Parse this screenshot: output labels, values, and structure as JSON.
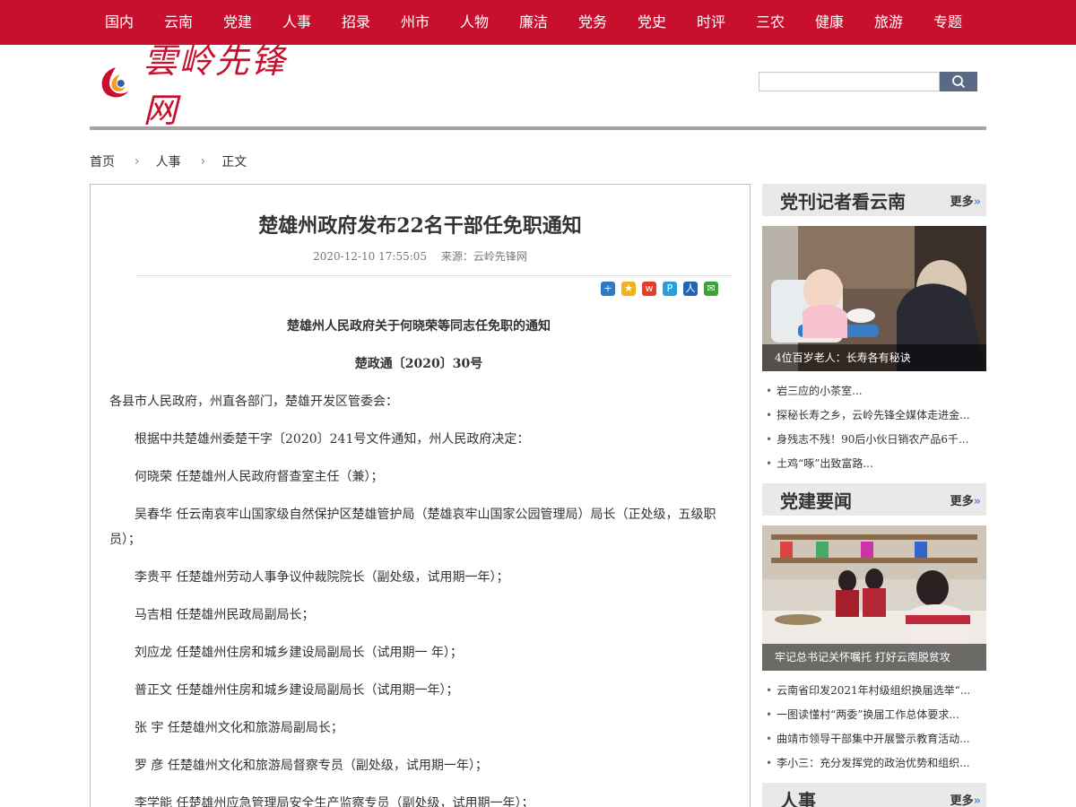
{
  "nav": [
    "国内",
    "云南",
    "党建",
    "人事",
    "招录",
    "州市",
    "人物",
    "廉洁",
    "党务",
    "党史",
    "时评",
    "三农",
    "健康",
    "旅游",
    "专题"
  ],
  "header": {
    "logo_text": "雲岭先锋网",
    "search_placeholder": ""
  },
  "breadcrumb": {
    "home": "首页",
    "section": "人事",
    "current": "正文"
  },
  "article": {
    "title": "楚雄州政府发布22名干部任免职通知",
    "date": "2020-12-10 17:55:05",
    "source": "来源：云岭先锋网",
    "share_icons": [
      "plus-share-icon",
      "qzone-share-icon",
      "weibo-share-icon",
      "qq-share-icon",
      "renren-share-icon",
      "wechat-share-icon"
    ],
    "paragraphs": [
      {
        "style": "center",
        "text": "楚雄州人民政府关于何晓荣等同志任免职的通知"
      },
      {
        "style": "center",
        "text": "楚政通〔2020〕30号"
      },
      {
        "style": "noindent",
        "text": "各县市人民政府，州直各部门，楚雄开发区管委会："
      },
      {
        "style": "indent",
        "text": "根据中共楚雄州委楚干字〔2020〕241号文件通知，州人民政府决定："
      },
      {
        "style": "indent",
        "text": "何晓荣 任楚雄州人民政府督查室主任（兼）；"
      },
      {
        "style": "indent",
        "text": "吴春华 任云南哀牢山国家级自然保护区楚雄管护局（楚雄哀牢山国家公园管理局）局长（正处级，五级职员）；"
      },
      {
        "style": "indent",
        "text": "李贵平 任楚雄州劳动人事争议仲裁院院长（副处级，试用期一年）；"
      },
      {
        "style": "indent",
        "text": "马吉相 任楚雄州民政局副局长；"
      },
      {
        "style": "indent",
        "text": "刘应龙 任楚雄州住房和城乡建设局副局长（试用期一 年）；"
      },
      {
        "style": "indent",
        "text": "普正文 任楚雄州住房和城乡建设局副局长（试用期一年）；"
      },
      {
        "style": "indent",
        "text": "张 宇 任楚雄州文化和旅游局副局长；"
      },
      {
        "style": "indent",
        "text": "罗 彦 任楚雄州文化和旅游局督察专员（副处级，试用期一年）；"
      },
      {
        "style": "indent",
        "text": "李学能 任楚雄州应急管理局安全生产监察专员（副处级，试用期一年）；"
      }
    ]
  },
  "sidebar": [
    {
      "title": "党刊记者看云南",
      "more": "更多",
      "caption": "4位百岁老人：长寿各有秘诀",
      "items": [
        "岩三应的小茶室...",
        "探秘长寿之乡，云岭先锋全媒体走进金...",
        "身残志不残！90后小伙日销农产品6千...",
        "土鸡“啄”出致富路..."
      ]
    },
    {
      "title": "党建要闻",
      "more": "更多",
      "caption": "牢记总书记关怀嘱托 打好云南脱贫攻",
      "items": [
        "云南省印发2021年村级组织换届选举“...",
        "一图读懂村“两委”换届工作总体要求...",
        "曲靖市领导干部集中开展警示教育活动...",
        "李小三：充分发挥党的政治优势和组织..."
      ]
    },
    {
      "title": "人事",
      "more": "更多"
    }
  ],
  "colors": {
    "brand_red": "#c8102e",
    "search_button": "#5a6a84",
    "more_arrow": "#6b8ccf"
  }
}
